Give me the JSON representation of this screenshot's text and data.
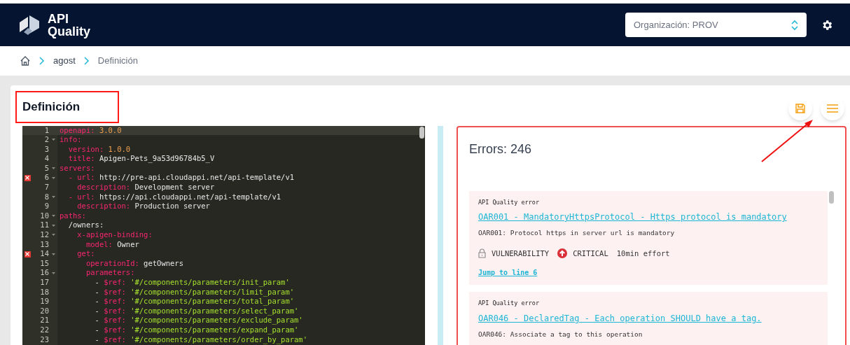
{
  "header": {
    "logo_line1": "API",
    "logo_line2": "Quality",
    "organization_select": "Organización: PROV"
  },
  "breadcrumb": [
    "agost",
    "Definición"
  ],
  "page": {
    "title": "Definición"
  },
  "editor": {
    "lines": [
      {
        "number": "1",
        "tokens": [
          {
            "kind": "key",
            "text": "openapi:"
          },
          {
            "kind": "number",
            "text": " 3.0.0"
          }
        ],
        "foldable": false,
        "error": false,
        "active": true
      },
      {
        "number": "2",
        "tokens": [
          {
            "kind": "key",
            "text": "info:"
          }
        ],
        "foldable": true,
        "error": false,
        "active": false
      },
      {
        "number": "3",
        "tokens": [
          {
            "kind": "key",
            "text": "  version:"
          },
          {
            "kind": "number",
            "text": " 1.0.0"
          }
        ],
        "foldable": false,
        "error": false,
        "active": false
      },
      {
        "number": "4",
        "tokens": [
          {
            "kind": "key",
            "text": "  title:"
          },
          {
            "kind": "plain",
            "text": " Apigen-Pets_9a53d96784b5_V"
          }
        ],
        "foldable": false,
        "error": false,
        "active": false
      },
      {
        "number": "5",
        "tokens": [
          {
            "kind": "key",
            "text": "servers:"
          }
        ],
        "foldable": true,
        "error": false,
        "active": false
      },
      {
        "number": "6",
        "tokens": [
          {
            "kind": "key",
            "text": "  - url:"
          },
          {
            "kind": "plain",
            "text": " http://pre-api.cloudappi.net/api-template/v1"
          }
        ],
        "foldable": true,
        "error": true,
        "active": false
      },
      {
        "number": "7",
        "tokens": [
          {
            "kind": "key",
            "text": "    description:"
          },
          {
            "kind": "plain",
            "text": " Development server"
          }
        ],
        "foldable": false,
        "error": false,
        "active": false
      },
      {
        "number": "8",
        "tokens": [
          {
            "kind": "key",
            "text": "  - url:"
          },
          {
            "kind": "plain",
            "text": " https://api.cloudappi.net/api-template/v1"
          }
        ],
        "foldable": true,
        "error": false,
        "active": false
      },
      {
        "number": "9",
        "tokens": [
          {
            "kind": "key",
            "text": "    description:"
          },
          {
            "kind": "plain",
            "text": " Production server"
          }
        ],
        "foldable": false,
        "error": false,
        "active": false
      },
      {
        "number": "10",
        "tokens": [
          {
            "kind": "key",
            "text": "paths:"
          }
        ],
        "foldable": true,
        "error": false,
        "active": false
      },
      {
        "number": "11",
        "tokens": [
          {
            "kind": "plain",
            "text": "  /owners:"
          }
        ],
        "foldable": true,
        "error": false,
        "active": false
      },
      {
        "number": "12",
        "tokens": [
          {
            "kind": "key",
            "text": "    x-apigen-binding:"
          }
        ],
        "foldable": true,
        "error": false,
        "active": false
      },
      {
        "number": "13",
        "tokens": [
          {
            "kind": "key",
            "text": "      model:"
          },
          {
            "kind": "plain",
            "text": " Owner"
          }
        ],
        "foldable": false,
        "error": false,
        "active": false
      },
      {
        "number": "14",
        "tokens": [
          {
            "kind": "key",
            "text": "    get:"
          }
        ],
        "foldable": true,
        "error": true,
        "active": false
      },
      {
        "number": "15",
        "tokens": [
          {
            "kind": "key",
            "text": "      operationId:"
          },
          {
            "kind": "plain",
            "text": " getOwners"
          }
        ],
        "foldable": false,
        "error": false,
        "active": false
      },
      {
        "number": "16",
        "tokens": [
          {
            "kind": "key",
            "text": "      parameters:"
          }
        ],
        "foldable": true,
        "error": false,
        "active": false
      },
      {
        "number": "17",
        "tokens": [
          {
            "kind": "plain",
            "text": "        - "
          },
          {
            "kind": "key",
            "text": "$ref:"
          },
          {
            "kind": "string",
            "text": " '#/components/parameters/init_param'"
          }
        ],
        "foldable": false,
        "error": false,
        "active": false
      },
      {
        "number": "18",
        "tokens": [
          {
            "kind": "plain",
            "text": "        - "
          },
          {
            "kind": "key",
            "text": "$ref:"
          },
          {
            "kind": "string",
            "text": " '#/components/parameters/limit_param'"
          }
        ],
        "foldable": false,
        "error": false,
        "active": false
      },
      {
        "number": "19",
        "tokens": [
          {
            "kind": "plain",
            "text": "        - "
          },
          {
            "kind": "key",
            "text": "$ref:"
          },
          {
            "kind": "string",
            "text": " '#/components/parameters/total_param'"
          }
        ],
        "foldable": false,
        "error": false,
        "active": false
      },
      {
        "number": "20",
        "tokens": [
          {
            "kind": "plain",
            "text": "        - "
          },
          {
            "kind": "key",
            "text": "$ref:"
          },
          {
            "kind": "string",
            "text": " '#/components/parameters/select_param'"
          }
        ],
        "foldable": false,
        "error": false,
        "active": false
      },
      {
        "number": "21",
        "tokens": [
          {
            "kind": "plain",
            "text": "        - "
          },
          {
            "kind": "key",
            "text": "$ref:"
          },
          {
            "kind": "string",
            "text": " '#/components/parameters/exclude_param'"
          }
        ],
        "foldable": false,
        "error": false,
        "active": false
      },
      {
        "number": "22",
        "tokens": [
          {
            "kind": "plain",
            "text": "        - "
          },
          {
            "kind": "key",
            "text": "$ref:"
          },
          {
            "kind": "string",
            "text": " '#/components/parameters/expand_param'"
          }
        ],
        "foldable": false,
        "error": false,
        "active": false
      },
      {
        "number": "23",
        "tokens": [
          {
            "kind": "plain",
            "text": "        - "
          },
          {
            "kind": "key",
            "text": "$ref:"
          },
          {
            "kind": "string",
            "text": " '#/components/parameters/order_by_param'"
          }
        ],
        "foldable": false,
        "error": false,
        "active": false
      }
    ]
  },
  "errors_panel": {
    "title": "Errors: 246",
    "items": [
      {
        "source": "API Quality error",
        "title": "OAR001 - MandatoryHttpsProtocol - Https protocol is mandatory",
        "description": "OAR001: Protocol https in server url is mandatory",
        "type": "VULNERABILITY",
        "severity": "CRITICAL",
        "effort": "10min effort",
        "jump": "Jump to line 6"
      },
      {
        "source": "API Quality error",
        "title": "OAR046 - DeclaredTag - Each operation SHOULD have a tag.",
        "description": "OAR046: Associate a tag to this operation"
      }
    ]
  }
}
